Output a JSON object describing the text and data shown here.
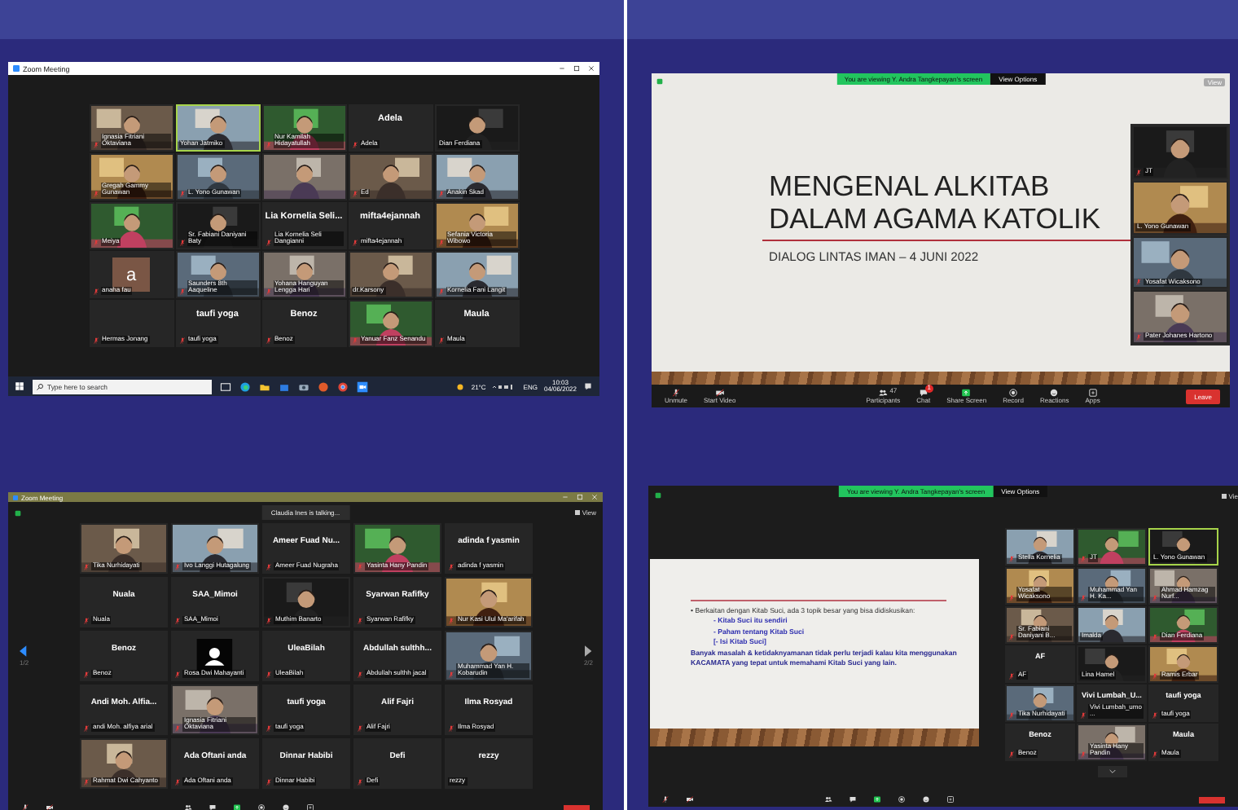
{
  "gallery_window": {
    "title": "Zoom Meeting",
    "tiles": [
      {
        "kind": "video",
        "label": "Ignasia Fitriani Oktaviana",
        "muted": true,
        "speaking": false
      },
      {
        "kind": "video",
        "label": "Yohan Jatmiko",
        "muted": false,
        "speaking": true
      },
      {
        "kind": "video",
        "label": "Nur Kamilah Hidayatullah",
        "muted": true,
        "speaking": false
      },
      {
        "kind": "name",
        "display_name": "Adela",
        "label": "Adela",
        "muted": true,
        "speaking": false
      },
      {
        "kind": "video",
        "label": "Dian Ferdiana",
        "muted": false,
        "speaking": false
      },
      {
        "kind": "video",
        "label": "Gregah Gammy Gunawan",
        "muted": true,
        "speaking": false
      },
      {
        "kind": "video",
        "label": "L. Yono Gunawan",
        "muted": true,
        "speaking": false
      },
      {
        "kind": "video",
        "muted": false,
        "speaking": false
      },
      {
        "kind": "video",
        "label": "Ed",
        "muted": true,
        "speaking": false
      },
      {
        "kind": "video",
        "label": "Anakin Skad",
        "muted": true,
        "speaking": false
      },
      {
        "kind": "video",
        "label": "Meiya",
        "muted": true,
        "speaking": false
      },
      {
        "kind": "video",
        "label": "Sr. Fabiani Daniyani Baty",
        "muted": true,
        "speaking": false
      },
      {
        "kind": "name",
        "display_name": "Lia Kornelia Seli...",
        "label": "Lia Kornelia Seli Dangianni",
        "muted": true,
        "speaking": false
      },
      {
        "kind": "name",
        "display_name": "mifta4ejannah",
        "label": "mifta4ejannah",
        "muted": true,
        "speaking": false
      },
      {
        "kind": "video",
        "label": "Sefania Victoria Wibowo",
        "muted": true,
        "speaking": false
      },
      {
        "kind": "avatar",
        "letter": "a",
        "label": "anaha fau",
        "muted": true,
        "speaking": false
      },
      {
        "kind": "video",
        "label": "Saunders 8th Aaqueline",
        "muted": true,
        "speaking": false
      },
      {
        "kind": "video",
        "label": "Yohana Hanguyan Lengga Hari",
        "muted": true,
        "speaking": false
      },
      {
        "kind": "video",
        "label": "dr.Karsony",
        "muted": false,
        "speaking": false
      },
      {
        "kind": "video",
        "label": "Kornelia Fani Langit",
        "muted": true,
        "speaking": false
      },
      {
        "kind": "blank",
        "label": "Hermas Jonang",
        "muted": true,
        "speaking": false
      },
      {
        "kind": "name",
        "display_name": "taufi yoga",
        "label": "taufi yoga",
        "muted": true,
        "speaking": false
      },
      {
        "kind": "name",
        "display_name": "Benoz",
        "label": "Benoz",
        "muted": true,
        "speaking": false
      },
      {
        "kind": "video",
        "label": "Yanuar Fanz Senandu",
        "muted": true,
        "speaking": false
      },
      {
        "kind": "name",
        "display_name": "Maula",
        "label": "Maula",
        "muted": true,
        "speaking": false
      }
    ],
    "taskbar": {
      "search_placeholder": "Type here to search",
      "weather": "21°C",
      "language": "ENG",
      "time": "10:03",
      "date": "04/06/2022"
    }
  },
  "share_window": {
    "banner": "You are viewing Y. Andra Tangkepayan's screen",
    "view_options": "View Options",
    "view": "View",
    "slide": {
      "title_lines": [
        "MENGENAL ALKITAB",
        "DALAM AGAMA KATOLIK"
      ],
      "subtitle": "DIALOG LINTAS IMAN – 4 JUNI 2022"
    },
    "tiles": [
      {
        "kind": "video",
        "label": "JT",
        "muted": true,
        "speaking": false
      },
      {
        "kind": "video",
        "label": "L. Yono Gunawan",
        "muted": false,
        "speaking": false
      },
      {
        "kind": "video",
        "label": "Yosafat Wicaksono",
        "muted": true,
        "speaking": false
      },
      {
        "kind": "video",
        "label": "Pater Johanes Hartono",
        "muted": true,
        "speaking": false
      }
    ],
    "toolbar_left": [
      {
        "kind": "mic",
        "label": "Unmute"
      },
      {
        "kind": "video",
        "label": "Start Video"
      }
    ],
    "toolbar_center": [
      {
        "kind": "participants",
        "label": "Participants",
        "count": "47"
      },
      {
        "kind": "chat",
        "label": "Chat",
        "badge": "1"
      },
      {
        "kind": "share",
        "label": "Share Screen"
      },
      {
        "kind": "record",
        "label": "Record"
      },
      {
        "kind": "reactions",
        "label": "Reactions"
      },
      {
        "kind": "apps",
        "label": "Apps"
      }
    ],
    "leave": "Leave"
  },
  "speaker_window": {
    "title": "Zoom Meeting",
    "talking": "Claudia Ines is talking...",
    "view": "View",
    "page_prev": "1/2",
    "page_next": "2/2",
    "tiles": [
      {
        "kind": "video",
        "label": "Tika Nurhidayati",
        "muted": true,
        "speaking": false
      },
      {
        "kind": "video",
        "label": "Ivo Langgi Hutagalung",
        "muted": true,
        "speaking": false
      },
      {
        "kind": "name",
        "display_name": "Ameer Fuad Nu...",
        "label": "Ameer Fuad Nugraha",
        "muted": true,
        "speaking": false
      },
      {
        "kind": "video",
        "label": "Yasinta Hany Pandin",
        "muted": true,
        "speaking": false
      },
      {
        "kind": "name",
        "display_name": "adinda f yasmin",
        "label": "adinda f yasmin",
        "muted": true,
        "speaking": false
      },
      {
        "kind": "name",
        "display_name": "Nuala",
        "label": "Nuala",
        "muted": true,
        "speaking": false
      },
      {
        "kind": "name",
        "display_name": "SAA_Mimoi",
        "label": "SAA_Mimoi",
        "muted": true,
        "speaking": false
      },
      {
        "kind": "video",
        "label": "Muthim Banarto",
        "muted": true,
        "speaking": false
      },
      {
        "kind": "name",
        "display_name": "Syarwan Rafifky",
        "label": "Syarwan Rafifky",
        "muted": true,
        "speaking": false
      },
      {
        "kind": "video",
        "label": "Nur Kasi Ulul Ma'arifah",
        "muted": true,
        "speaking": false
      },
      {
        "kind": "name",
        "display_name": "Benoz",
        "label": "Benoz",
        "muted": true,
        "speaking": false
      },
      {
        "kind": "avatar_icon",
        "label": "Rosa Dwi Mahayanti",
        "muted": true,
        "speaking": false
      },
      {
        "kind": "name",
        "display_name": "UleaBilah",
        "label": "UleaBilah",
        "muted": true,
        "speaking": false
      },
      {
        "kind": "name",
        "display_name": "Abdullah sulthh...",
        "label": "Abdullah sulthh jacal",
        "muted": true,
        "speaking": false
      },
      {
        "kind": "video",
        "label": "Muhammad Yan H. Kobarudin",
        "muted": true,
        "speaking": false
      },
      {
        "kind": "name",
        "display_name": "Andi Moh. Alfia...",
        "label": "andi Moh. alfiya arial",
        "muted": true,
        "speaking": false
      },
      {
        "kind": "video",
        "label": "Ignasia Fitriani Oktaviana",
        "muted": true,
        "speaking": false
      },
      {
        "kind": "name",
        "display_name": "taufi yoga",
        "label": "taufi yoga",
        "muted": true,
        "speaking": false
      },
      {
        "kind": "name",
        "display_name": "Alif Fajri",
        "label": "Alif Fajri",
        "muted": true,
        "speaking": false
      },
      {
        "kind": "name",
        "display_name": "Ilma Rosyad",
        "label": "Ilma Rosyad",
        "muted": true,
        "speaking": false
      },
      {
        "kind": "video",
        "label": "Rahmat Dwi Cahyanto",
        "muted": true,
        "speaking": false
      },
      {
        "kind": "name",
        "display_name": "Ada Oftani anda",
        "label": "Ada Oftani anda",
        "muted": true,
        "speaking": false
      },
      {
        "kind": "name",
        "display_name": "Dinnar Habibi",
        "label": "Dinnar Habibi",
        "muted": true,
        "speaking": false
      },
      {
        "kind": "name",
        "display_name": "Defi",
        "label": "Defi",
        "muted": true,
        "speaking": false
      },
      {
        "kind": "name",
        "display_name": "rezzy",
        "label": "rezzy",
        "muted": false,
        "speaking": false
      }
    ]
  },
  "share_gallery_window": {
    "banner": "You are viewing Y. Andra Tangkepayan's screen",
    "view_options": "View Options",
    "view": "Vie",
    "slide": {
      "lines": [
        {
          "kind": "bullet",
          "text": "• Berkaitan dengan Kitab Suci, ada 3 topik besar yang bisa didiskusikan:"
        },
        {
          "kind": "sub",
          "text": "- Kitab Suci itu sendiri"
        },
        {
          "kind": "sub",
          "text": "- Paham tentang Kitab Suci"
        },
        {
          "kind": "sub",
          "text": "[- Isi Kitab Suci]"
        },
        {
          "kind": "para",
          "text": "Banyak masalah & ketidaknyamanan tidak perlu terjadi kalau kita menggunakan KACAMATA yang tepat untuk memahami Kitab Suci yang lain."
        }
      ]
    },
    "tiles": [
      {
        "kind": "video",
        "label": "Stella Kornelia",
        "muted": true,
        "speaking": false
      },
      {
        "kind": "video",
        "label": "JT",
        "muted": true,
        "speaking": false
      },
      {
        "kind": "video",
        "label": "L. Yono Gunawan",
        "muted": false,
        "speaking": true
      },
      {
        "kind": "video",
        "label": "Yosafat Wicaksono",
        "muted": true,
        "speaking": false
      },
      {
        "kind": "video",
        "label": "Muhammad Yan H. Ka...",
        "muted": true,
        "speaking": false
      },
      {
        "kind": "video",
        "label": "Ahmad Hamzag Nurf...",
        "muted": true,
        "speaking": false
      },
      {
        "kind": "video",
        "label": "Sr. Fabiani Daniyani B...",
        "muted": true,
        "speaking": false
      },
      {
        "kind": "video",
        "label": "Imalda",
        "muted": false,
        "speaking": false
      },
      {
        "kind": "video",
        "label": "Dian Ferdiana",
        "muted": true,
        "speaking": false
      },
      {
        "kind": "name",
        "display_name": "AF",
        "label": "AF",
        "muted": true,
        "speaking": false
      },
      {
        "kind": "video",
        "label": "Lina Hamel",
        "muted": false,
        "speaking": false
      },
      {
        "kind": "video",
        "label": "Ramis Erbar",
        "muted": true,
        "speaking": false
      },
      {
        "kind": "video",
        "label": "Tika Nurhidayati",
        "muted": true,
        "speaking": false
      },
      {
        "kind": "name",
        "display_name": "Vivi Lumbah_U...",
        "label": "Vivi Lumbah_umo ...",
        "muted": true,
        "speaking": false
      },
      {
        "kind": "name",
        "display_name": "taufi yoga",
        "label": "taufi yoga",
        "muted": true,
        "speaking": false
      },
      {
        "kind": "name",
        "display_name": "Benoz",
        "label": "Benoz",
        "muted": true,
        "speaking": false
      },
      {
        "kind": "video",
        "label": "Yasinta Hany Pandin",
        "muted": true,
        "speaking": false
      },
      {
        "kind": "name",
        "display_name": "Maula",
        "label": "Maula",
        "muted": true,
        "speaking": false
      }
    ]
  }
}
